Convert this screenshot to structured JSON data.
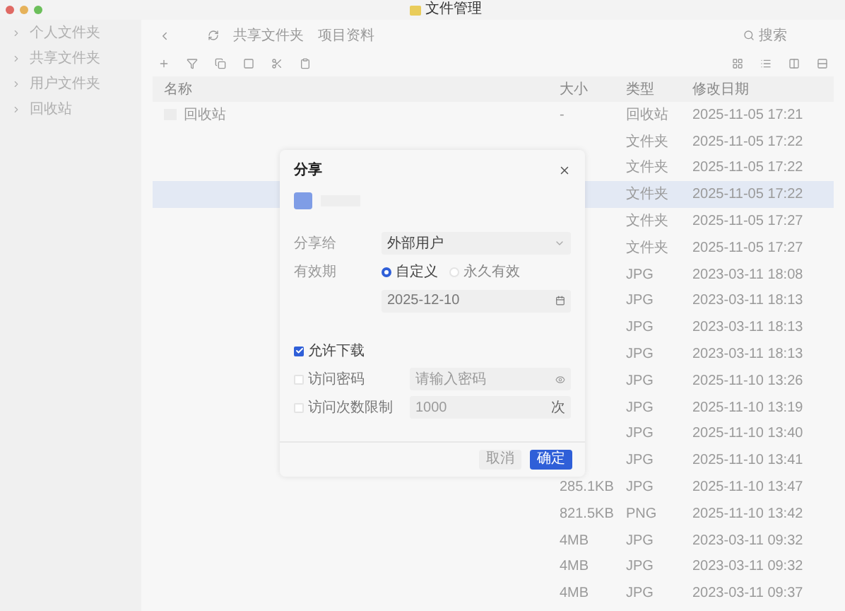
{
  "window": {
    "title": "文件管理"
  },
  "sidebar": {
    "items": [
      {
        "label": "个人文件夹"
      },
      {
        "label": "共享文件夹"
      },
      {
        "label": "用户文件夹"
      },
      {
        "label": "回收站"
      }
    ]
  },
  "breadcrumb": [
    "共享文件夹",
    "项目资料"
  ],
  "search": {
    "placeholder": "搜索"
  },
  "table": {
    "columns": [
      "名称",
      "大小",
      "类型",
      "修改日期"
    ],
    "rows": [
      {
        "name": "回收站",
        "size": "-",
        "type": "回收站",
        "date": "2025-11-05 17:21",
        "selected": false
      },
      {
        "type": "文件夹",
        "date": "2025-11-05 17:22",
        "selected": false
      },
      {
        "type": "文件夹",
        "date": "2025-11-05 17:22",
        "selected": false
      },
      {
        "type": "文件夹",
        "date": "2025-11-05 17:22",
        "selected": true
      },
      {
        "type": "文件夹",
        "date": "2025-11-05 17:27",
        "selected": false
      },
      {
        "type": "文件夹",
        "date": "2025-11-05 17:27",
        "selected": false
      },
      {
        "type": "JPG",
        "date": "2023-03-11 18:08",
        "selected": false
      },
      {
        "type": "JPG",
        "date": "2023-03-11 18:13",
        "selected": false
      },
      {
        "type": "JPG",
        "date": "2023-03-11 18:13",
        "selected": false
      },
      {
        "type": "JPG",
        "date": "2023-03-11 18:13",
        "selected": false
      },
      {
        "type": "JPG",
        "date": "2025-11-10 13:26",
        "selected": false
      },
      {
        "type": "JPG",
        "date": "2025-11-10 13:19",
        "selected": false
      },
      {
        "type": "JPG",
        "date": "2025-11-10 13:40",
        "selected": false
      },
      {
        "type": "JPG",
        "date": "2025-11-10 13:41",
        "selected": false
      },
      {
        "size": "285.1KB",
        "type": "JPG",
        "date": "2025-11-10 13:47",
        "selected": false
      },
      {
        "size": "821.5KB",
        "type": "PNG",
        "date": "2025-11-10 13:42",
        "selected": false
      },
      {
        "size": "4MB",
        "type": "JPG",
        "date": "2023-03-11 09:32",
        "selected": false
      },
      {
        "size": "4MB",
        "type": "JPG",
        "date": "2023-03-11 09:32",
        "selected": false
      },
      {
        "size": "4MB",
        "type": "JPG",
        "date": "2023-03-11 09:37",
        "selected": false
      }
    ]
  },
  "dialog": {
    "title": "分享",
    "share_to": {
      "label": "分享给",
      "value": "外部用户"
    },
    "validity": {
      "label": "有效期",
      "options": [
        {
          "label": "自定义",
          "selected": true
        },
        {
          "label": "永久有效",
          "selected": false
        }
      ],
      "date": "2025-12-10"
    },
    "options": [
      {
        "kind": "plain",
        "label": "允许下载",
        "checked": true
      },
      {
        "kind": "password",
        "label": "访问密码",
        "checked": false,
        "placeholder": "请输入密码"
      },
      {
        "kind": "count",
        "label": "访问次数限制",
        "checked": false,
        "placeholder": "1000",
        "suffix": "次"
      }
    ],
    "buttons": [
      {
        "label": "取消",
        "primary": false
      },
      {
        "label": "确定",
        "primary": true
      }
    ]
  }
}
